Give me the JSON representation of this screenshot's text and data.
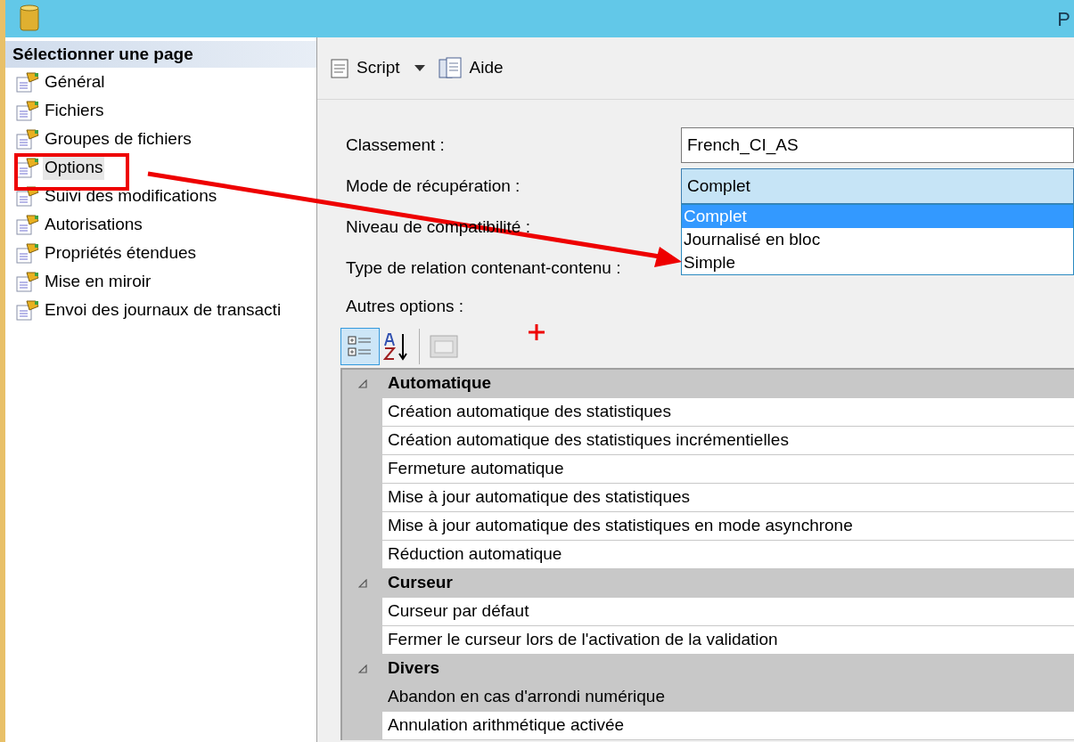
{
  "window": {
    "title": "P"
  },
  "sidebar": {
    "header": "Sélectionner une page",
    "items": [
      {
        "label": "Général",
        "selected": false
      },
      {
        "label": "Fichiers",
        "selected": false
      },
      {
        "label": "Groupes de fichiers",
        "selected": false
      },
      {
        "label": "Options",
        "selected": true
      },
      {
        "label": "Suivi des modifications",
        "selected": false
      },
      {
        "label": "Autorisations",
        "selected": false
      },
      {
        "label": "Propriétés étendues",
        "selected": false
      },
      {
        "label": "Mise en miroir",
        "selected": false
      },
      {
        "label": "Envoi des journaux de transacti",
        "selected": false
      }
    ]
  },
  "toolbar": {
    "script": "Script",
    "help": "Aide"
  },
  "fields": [
    {
      "label": "Classement :",
      "kind": "text",
      "value": "French_CI_AS"
    },
    {
      "label": "Mode de récupération :",
      "kind": "open-dropdown",
      "value": "Complet",
      "options": [
        {
          "label": "Complet",
          "selected": true
        },
        {
          "label": "Journalisé en bloc",
          "selected": false
        },
        {
          "label": "Simple",
          "selected": false
        }
      ]
    },
    {
      "label": "Niveau de compatibilité :",
      "kind": "covered"
    },
    {
      "label": "Type de relation contenant-contenu :",
      "kind": "covered"
    }
  ],
  "other_options": {
    "label": "Autres options :",
    "categorized_selected": true
  },
  "grid": [
    {
      "name": "Automatique",
      "expanded": true,
      "rows": [
        {
          "label": "Création automatique des statistiques",
          "selected": false
        },
        {
          "label": "Création automatique des statistiques incrémentielles",
          "selected": false
        },
        {
          "label": "Fermeture automatique",
          "selected": false
        },
        {
          "label": "Mise à jour automatique des statistiques",
          "selected": false
        },
        {
          "label": "Mise à jour automatique des statistiques en mode asynchrone",
          "selected": false
        },
        {
          "label": "Réduction automatique",
          "selected": false
        }
      ]
    },
    {
      "name": "Curseur",
      "expanded": true,
      "rows": [
        {
          "label": "Curseur par défaut",
          "selected": false
        },
        {
          "label": "Fermer le curseur lors de l'activation de la validation",
          "selected": false
        }
      ]
    },
    {
      "name": "Divers",
      "expanded": true,
      "rows": [
        {
          "label": "Abandon en cas d'arrondi numérique",
          "selected": true
        },
        {
          "label": "Annulation arithmétique activée",
          "selected": false
        }
      ]
    }
  ]
}
